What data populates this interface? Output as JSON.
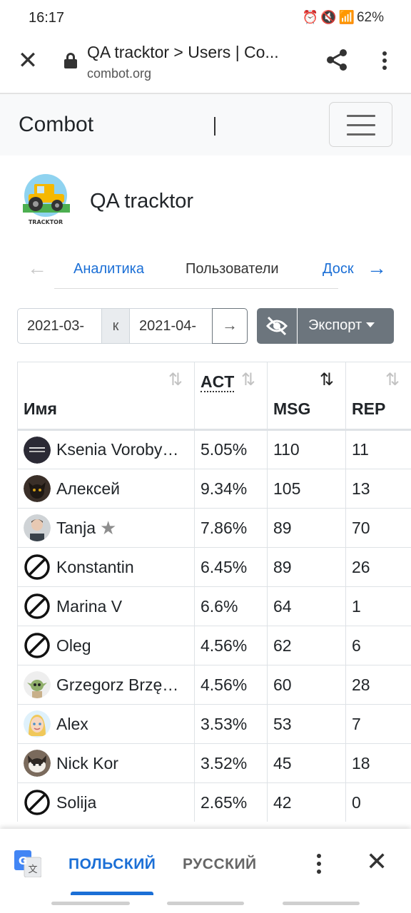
{
  "status_bar": {
    "time": "16:17",
    "icons": [
      "alarm-icon",
      "mute-icon",
      "wifi-icon",
      "call-icon",
      "signal-icon",
      "signal-icon"
    ],
    "battery": "62%"
  },
  "browser": {
    "title": "QA tracktor > Users | Co...",
    "url": "combot.org"
  },
  "navbar": {
    "brand": "Combot"
  },
  "group": {
    "name": "QA tracktor",
    "logo_text": "TRACKTOR"
  },
  "tabs": [
    {
      "label": "Аналитика",
      "active": false
    },
    {
      "label": "Пользователи",
      "active": true
    },
    {
      "label": "Доск",
      "active": false
    }
  ],
  "filter": {
    "date_from": "2021-03-",
    "separator": "к",
    "date_to": "2021-04-",
    "go": "→",
    "export_label": "Экспорт"
  },
  "table": {
    "headers": {
      "name": "Имя",
      "act": "ACT",
      "msg": "MSG",
      "rep": "REP"
    },
    "rows": [
      {
        "name": "Ksenia Vorobyova",
        "act": "5.05%",
        "msg": "110",
        "rep": "11",
        "avatar": "dark"
      },
      {
        "name": "Алексей",
        "act": "9.34%",
        "msg": "105",
        "rep": "13",
        "avatar": "cat"
      },
      {
        "name": "Tanja",
        "act": "7.86%",
        "msg": "89",
        "rep": "70",
        "avatar": "person",
        "star": true
      },
      {
        "name": "Konstantin",
        "act": "6.45%",
        "msg": "89",
        "rep": "26",
        "avatar": "none"
      },
      {
        "name": "Marina V",
        "act": "6.6%",
        "msg": "64",
        "rep": "1",
        "avatar": "none"
      },
      {
        "name": "Oleg",
        "act": "4.56%",
        "msg": "62",
        "rep": "6",
        "avatar": "none"
      },
      {
        "name": "Grzegorz Brzęczyszczykiewicz",
        "act": "4.56%",
        "msg": "60",
        "rep": "28",
        "avatar": "yoda"
      },
      {
        "name": "Alex",
        "act": "3.53%",
        "msg": "53",
        "rep": "7",
        "avatar": "girl"
      },
      {
        "name": "Nick Kor",
        "act": "3.52%",
        "msg": "45",
        "rep": "18",
        "avatar": "cat2"
      },
      {
        "name": "Solija",
        "act": "2.65%",
        "msg": "42",
        "rep": "0",
        "avatar": "none"
      }
    ]
  },
  "translate": {
    "source": "ПОЛЬСКИЙ",
    "target": "РУССКИЙ"
  },
  "colors": {
    "link": "#1b6fd6",
    "button_secondary": "#6c757d",
    "navbar_bg": "#f8f9fa"
  }
}
